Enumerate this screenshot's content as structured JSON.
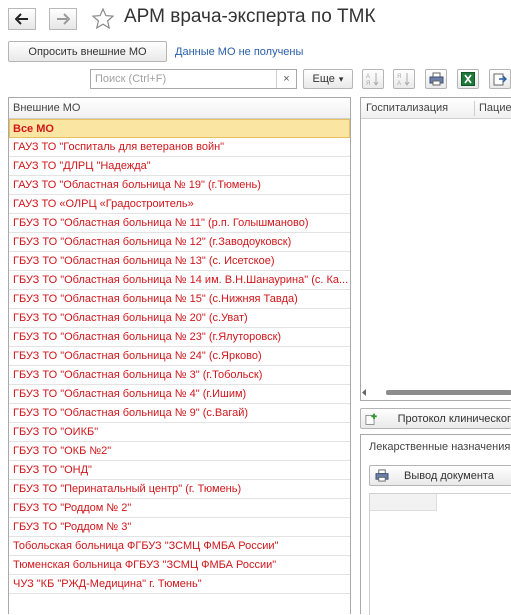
{
  "window": {
    "title": "АРМ врача-эксперта по ТМК"
  },
  "toolbar": {
    "query_button": "Опросить внешние МО",
    "status_link": "Данные МО не получены",
    "search_placeholder": "Поиск (Ctrl+F)",
    "search_clear": "×",
    "more_button": "Еще",
    "more_chevron": "▾"
  },
  "left_table": {
    "header": "Внешние МО",
    "selected_index": 0,
    "rows": [
      "Все МО",
      "ГАУЗ ТО \"Госпиталь для ветеранов войн\"",
      "ГАУЗ ТО \"ДЛРЦ \"Надежда\"",
      "ГАУЗ ТО \"Областная больница № 19\" (г.Тюмень)",
      "ГАУЗ ТО «ОЛРЦ «Градостроитель»",
      "ГБУЗ ТО \"Областная больница № 11\" (р.п. Голышманово)",
      "ГБУЗ ТО \"Областная больница № 12\" (г.Заводоуковск)",
      "ГБУЗ ТО \"Областная больница № 13\" (с. Исетское)",
      "ГБУЗ ТО \"Областная больница № 14 им. В.Н.Шанаурина\" (с. Ка...",
      "ГБУЗ ТО \"Областная больница № 15\" (с.Нижняя Тавда)",
      "ГБУЗ ТО \"Областная больница № 20\" (с.Уват)",
      "ГБУЗ ТО \"Областная больница № 23\" (г.Ялуторовск)",
      "ГБУЗ ТО \"Областная больница № 24\" (с.Ярково)",
      "ГБУЗ ТО \"Областная больница № 3\" (г.Тобольск)",
      "ГБУЗ ТО \"Областная больница № 4\" (г.Ишим)",
      "ГБУЗ ТО \"Областная больница № 9\" (с.Вагай)",
      "ГБУЗ ТО \"ОИКБ\"",
      "ГБУЗ ТО \"ОКБ №2\"",
      "ГБУЗ ТО \"ОНД\"",
      "ГБУЗ ТО \"Перинатальный центр\" (г. Тюмень)",
      "ГБУЗ ТО \"Роддом № 2\"",
      "ГБУЗ ТО \"Роддом № 3\"",
      "Тобольская больница ФГБУЗ \"ЗСМЦ ФМБА  России\"",
      "Тюменская больница ФГБУЗ \"ЗСМЦ ФМБА России\"",
      "ЧУЗ \"КБ \"РЖД-Медицина\" г. Тюмень\""
    ]
  },
  "right_table": {
    "col_hospitalization": "Госпитализация",
    "col_patient": "Пациен"
  },
  "protocol_button": "Протокол клиническог",
  "drugs_panel": {
    "title": "Лекарственные назначения",
    "print_button": "Вывод документа"
  },
  "colors": {
    "row_text": "#d0161b",
    "selected_bg": "#fae6a2",
    "link": "#2b5ea8",
    "excel": "#1f7a3a"
  },
  "icons": {
    "back": "arrow-left-icon",
    "forward": "arrow-right-icon",
    "favorite": "star-icon",
    "sort_asc": "sort-ascending-icon",
    "sort_desc": "sort-descending-icon",
    "print": "printer-icon",
    "excel": "excel-icon",
    "export": "export-icon",
    "add": "add-plus-icon"
  }
}
